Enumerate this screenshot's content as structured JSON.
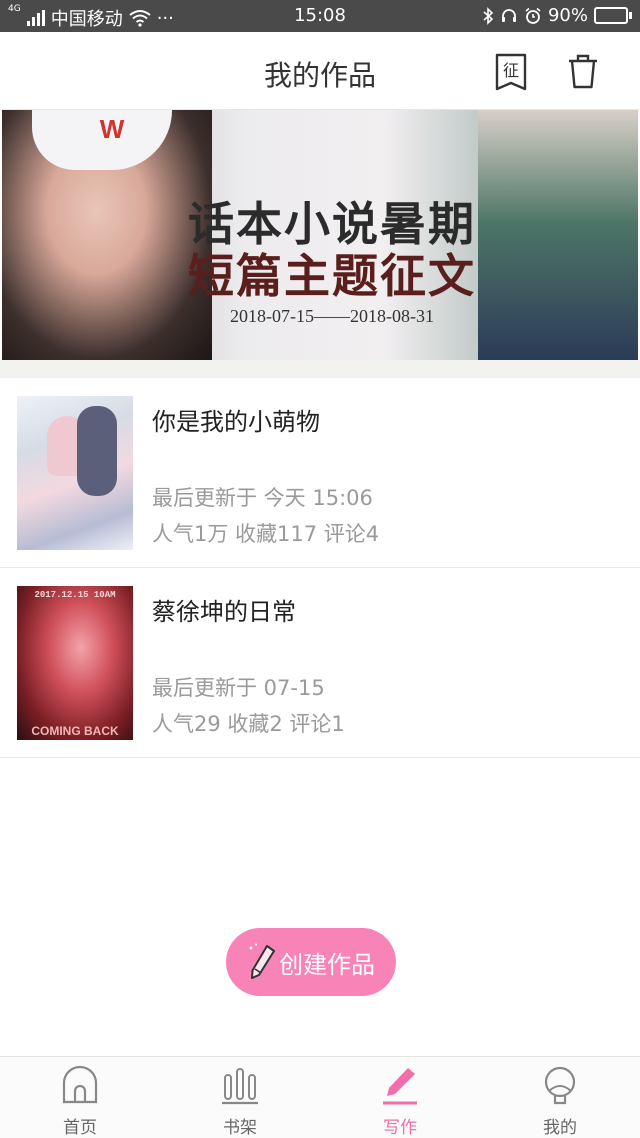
{
  "status_bar": {
    "network": "4G",
    "carrier": "中国移动",
    "more": "···",
    "time": "15:08",
    "battery": "90%",
    "battery_level": 0.9
  },
  "header": {
    "title": "我的作品",
    "contest_icon_text": "征"
  },
  "banner": {
    "line1": "话本小说暑期",
    "line2": "短篇主题征文",
    "dates": "2018-07-15——2018-08-31",
    "cap_logo": "W"
  },
  "works": [
    {
      "title": "你是我的小萌物",
      "updated": "最后更新于 今天 15:06",
      "stats": "人气1万  收藏117  评论4"
    },
    {
      "title": "蔡徐坤的日常",
      "updated": "最后更新于 07-15",
      "stats": "人气29  收藏2  评论1",
      "cover_top_text": "2017.12.15 10AM",
      "cover_bottom_text": "COMING BACK"
    }
  ],
  "create_button": {
    "label": "创建作品"
  },
  "nav": [
    {
      "label": "首页",
      "icon": "home-icon"
    },
    {
      "label": "书架",
      "icon": "bookshelf-icon"
    },
    {
      "label": "写作",
      "icon": "pen-icon",
      "active": true
    },
    {
      "label": "我的",
      "icon": "profile-icon"
    }
  ],
  "colors": {
    "accent": "#f06ea9",
    "create_button": "#f783b7",
    "status_bar": "#4a4a4a",
    "secondary_text": "#9a9a9a"
  }
}
